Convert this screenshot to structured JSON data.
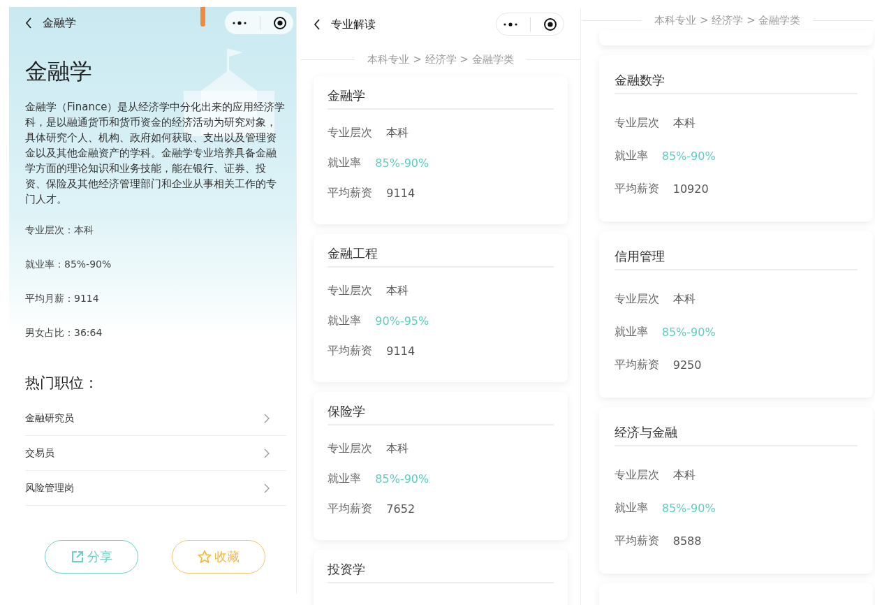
{
  "panels": [
    {
      "kind": "detail",
      "nav": {
        "title": "金融学"
      },
      "heading": "金融学",
      "description": "金融学（Finance）是从经济学中分化出来的应用经济学科，是以融通货币和货币资金的经济活动为研究对象，具体研究个人、机构、政府如何获取、支出以及管理资金以及其他金融资产的学科。金融学专业培养具备金融学方面的理论知识和业务技能，能在银行、证券、投资、保险及其他经济管理部门和企业从事相关工作的专门人才。",
      "facts": [
        {
          "label": "专业层次：",
          "value": "本科"
        },
        {
          "label": "就业率：",
          "value": "85%-90%"
        },
        {
          "label": "平均月薪：",
          "value": "9114"
        },
        {
          "label": "男女占比：",
          "value": "36:64"
        }
      ],
      "jobs_title": "热门职位：",
      "jobs": [
        "金融研究员",
        "交易员",
        "风险管理岗"
      ],
      "actions": [
        {
          "kind": "share",
          "label": "分享"
        },
        {
          "kind": "favorite",
          "label": "收藏"
        }
      ]
    },
    {
      "kind": "list",
      "nav": {
        "title": "专业解读"
      },
      "breadcrumb": "本科专业 > 经济学 > 金融学类",
      "majors": [
        {
          "name": "金融学",
          "fields": [
            {
              "kind": "plain",
              "label": "专业层次",
              "value": "本科"
            },
            {
              "kind": "rate",
              "label": "就业率",
              "value": "85%-90%"
            },
            {
              "kind": "plain",
              "label": "平均薪资",
              "value": "9114"
            }
          ]
        },
        {
          "name": "金融工程",
          "fields": [
            {
              "kind": "plain",
              "label": "专业层次",
              "value": "本科"
            },
            {
              "kind": "rate",
              "label": "就业率",
              "value": "90%-95%"
            },
            {
              "kind": "plain",
              "label": "平均薪资",
              "value": "9114"
            }
          ]
        },
        {
          "name": "保险学",
          "fields": [
            {
              "kind": "plain",
              "label": "专业层次",
              "value": "本科"
            },
            {
              "kind": "rate",
              "label": "就业率",
              "value": "85%-90%"
            },
            {
              "kind": "plain",
              "label": "平均薪资",
              "value": "7652"
            }
          ]
        },
        {
          "name": "投资学"
        }
      ]
    },
    {
      "kind": "list",
      "breadcrumb": "本科专业 > 经济学 > 金融学类",
      "scrolled": true,
      "trailing_card": true,
      "majors": [
        {
          "name": "金融数学",
          "fields": [
            {
              "kind": "plain",
              "label": "专业层次",
              "value": "本科"
            },
            {
              "kind": "rate",
              "label": "就业率",
              "value": "85%-90%"
            },
            {
              "kind": "plain",
              "label": "平均薪资",
              "value": "10920"
            }
          ]
        },
        {
          "name": "信用管理",
          "fields": [
            {
              "kind": "plain",
              "label": "专业层次",
              "value": "本科"
            },
            {
              "kind": "rate",
              "label": "就业率",
              "value": "85%-90%"
            },
            {
              "kind": "plain",
              "label": "平均薪资",
              "value": "9250"
            }
          ]
        },
        {
          "name": "经济与金融",
          "fields": [
            {
              "kind": "plain",
              "label": "专业层次",
              "value": "本科"
            },
            {
              "kind": "rate",
              "label": "就业率",
              "value": "85%-90%"
            },
            {
              "kind": "plain",
              "label": "平均薪资",
              "value": "8588"
            }
          ]
        }
      ]
    }
  ]
}
